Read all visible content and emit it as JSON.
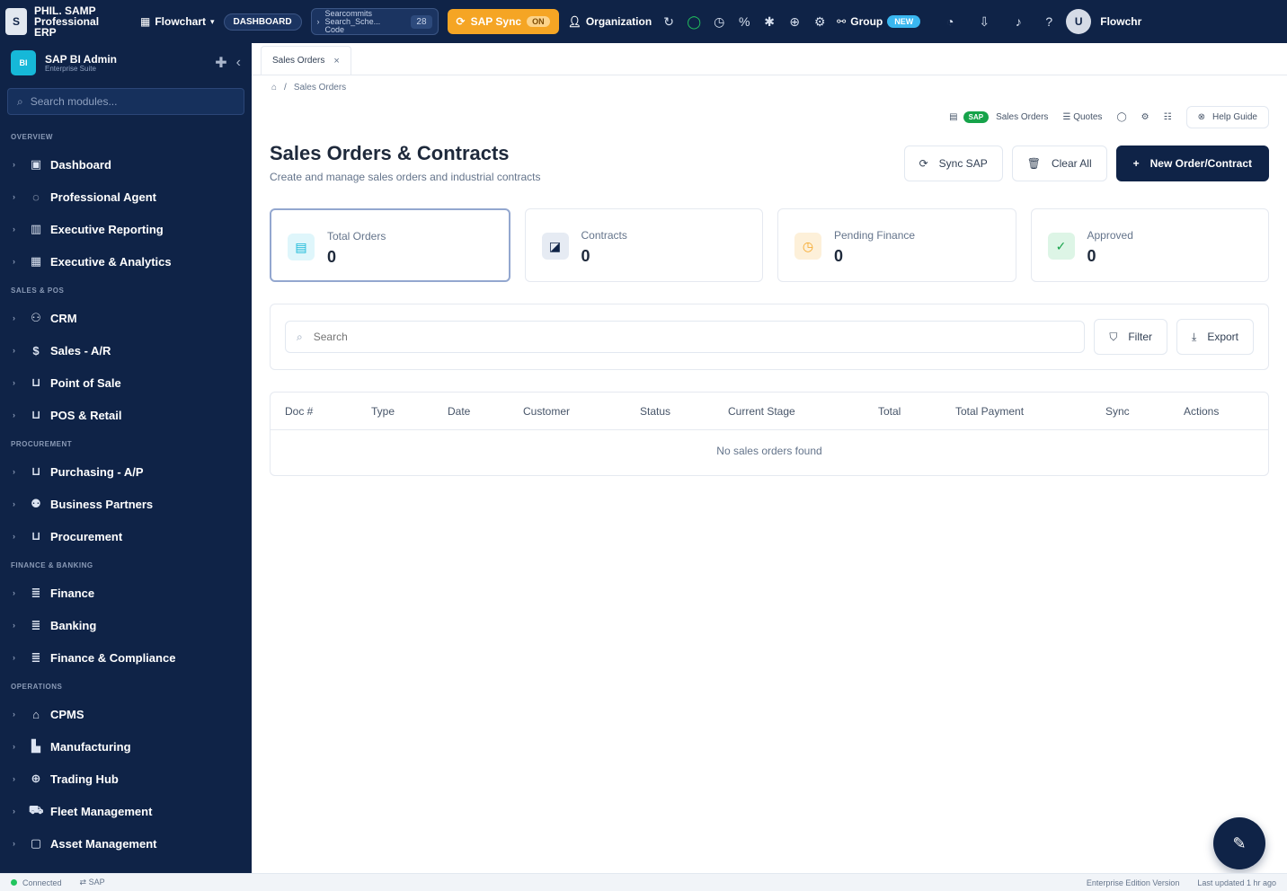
{
  "topbar": {
    "brand_line1": "PHIL. SAMP",
    "brand_line2": "Professional",
    "brand_line3": "ERP",
    "home_label": "Flowchart",
    "pill_label": "DASHBOARD",
    "box_line1": "Searcommits",
    "box_line2": "Search_Sche...",
    "box_line3": "Code",
    "box_num": "28",
    "sync_label": "SAP Sync",
    "sync_badge": "ON",
    "org_label": "Organization",
    "group_label": "Group",
    "group_badge": "NEW",
    "user_label": "Flowchr"
  },
  "sidebar": {
    "title": "SAP BI Admin",
    "subtitle": "Enterprise Suite",
    "search_placeholder": "Search modules...",
    "sections": {
      "overview": "OVERVIEW",
      "sales": "SALES & POS",
      "procurement": "PROCUREMENT",
      "finance": "FINANCE & BANKING",
      "operations": "OPERATIONS"
    },
    "items": {
      "dashboard": "Dashboard",
      "agent": "Professional Agent",
      "exec_reporting": "Executive Reporting",
      "exec_analytics": "Executive & Analytics",
      "crm": "CRM",
      "sales_ar": "Sales - A/R",
      "pos": "Point of Sale",
      "pos_retail": "POS & Retail",
      "purchasing": "Purchasing - A/P",
      "partners": "Business Partners",
      "procurement": "Procurement",
      "finance": "Finance",
      "banking": "Banking",
      "fin_compliance": "Finance & Compliance",
      "cpms": "CPMS",
      "manufacturing": "Manufacturing",
      "trading": "Trading Hub",
      "fleet": "Fleet Management",
      "asset": "Asset Management"
    }
  },
  "tab": {
    "label": "Sales Orders"
  },
  "breadcrumb": {
    "current": "Sales Orders"
  },
  "util": {
    "sap_badge": "SAP",
    "sales_orders": "Sales Orders",
    "quotes": "Quotes",
    "help": "Help Guide"
  },
  "page": {
    "title": "Sales Orders & Contracts",
    "subtitle": "Create and manage sales orders and industrial contracts"
  },
  "actions": {
    "sync": "Sync SAP",
    "clear": "Clear All",
    "new": "New Order/Contract"
  },
  "stats": [
    {
      "label": "Total Orders",
      "value": "0"
    },
    {
      "label": "Contracts",
      "value": "0"
    },
    {
      "label": "Pending Finance",
      "value": "0"
    },
    {
      "label": "Approved",
      "value": "0"
    }
  ],
  "filter": {
    "search_placeholder": "Search",
    "filter_label": "Filter",
    "export_label": "Export"
  },
  "table": {
    "columns": [
      "Doc #",
      "Type",
      "Date",
      "Customer",
      "Status",
      "Current Stage",
      "Total",
      "Total Payment",
      "Sync",
      "Actions"
    ],
    "empty": "No sales orders found"
  },
  "status": {
    "connected": "Connected",
    "sap": "SAP",
    "right1": "Enterprise Edition Version",
    "right2": "Last updated 1 hr ago"
  },
  "colors": {
    "nav": "#0f2347",
    "accent": "#f5a524",
    "teal": "#16b8d8",
    "success": "#16a34a"
  }
}
